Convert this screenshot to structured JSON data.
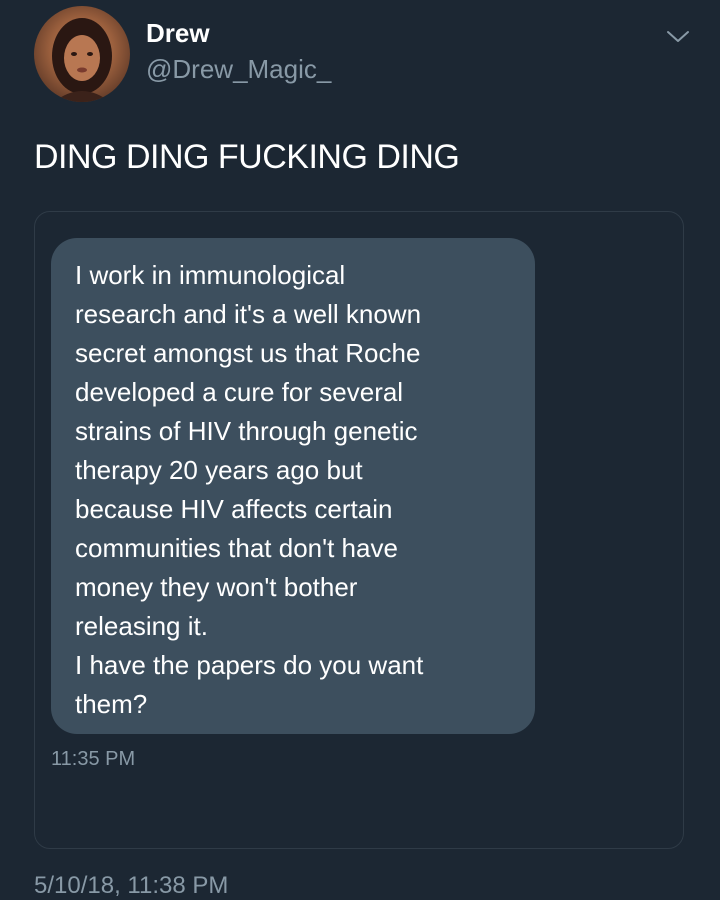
{
  "author": {
    "display_name": "Drew",
    "handle": "@Drew_Magic_",
    "avatar_icon": "profile-photo",
    "menu_icon": "chevron-down-icon"
  },
  "tweet": {
    "text": "DING DING FUCKING DING",
    "timestamp": "5/10/18, 11:38 PM"
  },
  "quoted_message": {
    "lines": [
      "I work in immunological",
      "research and it's a well known",
      "secret amongst us that Roche",
      "developed a cure for several",
      "strains of HIV through genetic",
      "therapy 20 years ago but",
      "because HIV affects certain",
      "communities that don't have",
      "money they won't bother",
      "releasing it.",
      "I have the papers do you want",
      "them?"
    ],
    "time": "11:35 PM"
  },
  "colors": {
    "background": "#1c2733",
    "bubble": "#3d4f5e",
    "secondary_text": "#8899a6",
    "card_border": "#2f3b47"
  }
}
